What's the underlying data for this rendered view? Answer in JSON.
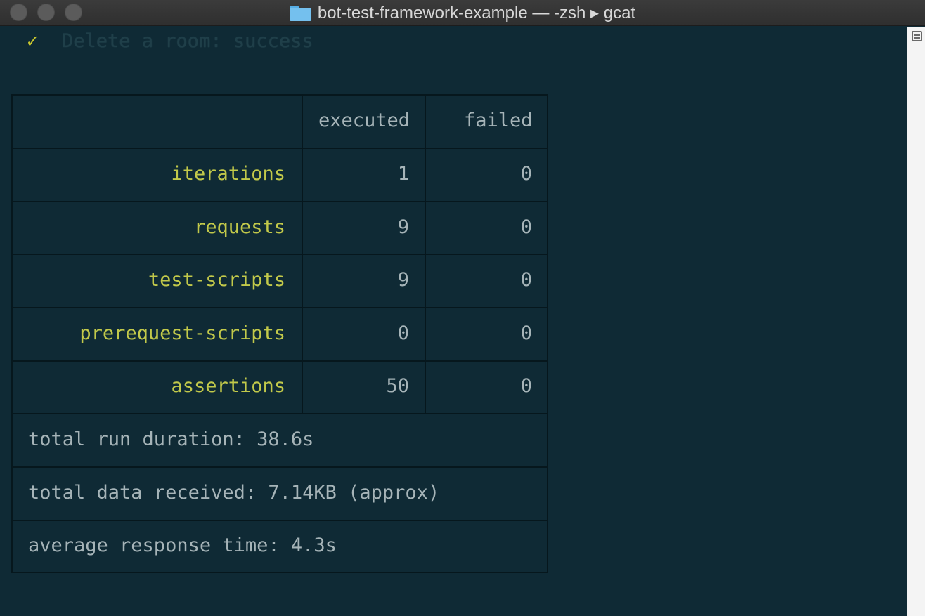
{
  "window": {
    "title": "bot-test-framework-example — -zsh ▸ gcat",
    "icon": "folder-icon"
  },
  "terminal": {
    "status_line": {
      "symbol": "✓",
      "text": "Delete a room: success"
    },
    "table": {
      "headers": [
        "",
        "executed",
        "failed"
      ],
      "rows": [
        {
          "label": "iterations",
          "executed": "1",
          "failed": "0"
        },
        {
          "label": "requests",
          "executed": "9",
          "failed": "0"
        },
        {
          "label": "test-scripts",
          "executed": "9",
          "failed": "0"
        },
        {
          "label": "prerequest-scripts",
          "executed": "0",
          "failed": "0"
        },
        {
          "label": "assertions",
          "executed": "50",
          "failed": "0"
        }
      ],
      "summary": [
        "total run duration: 38.6s",
        "total data received: 7.14KB (approx)",
        "average response time: 4.3s"
      ]
    }
  },
  "colors": {
    "background": "#0f2a35",
    "label": "#c2c94a",
    "text": "#a6b4b8",
    "check": "#c8c62e"
  }
}
